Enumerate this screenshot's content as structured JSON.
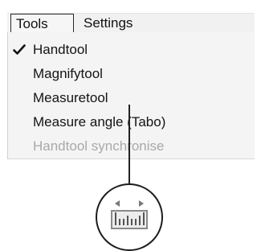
{
  "menubar": {
    "tabs": [
      {
        "label": "Tools",
        "active": true
      },
      {
        "label": "Settings",
        "active": false
      }
    ]
  },
  "tools_menu": {
    "items": [
      {
        "label": "Handtool",
        "checked": true,
        "enabled": true
      },
      {
        "label": "Magnifytool",
        "checked": false,
        "enabled": true
      },
      {
        "label": "Measuretool",
        "checked": false,
        "enabled": true
      },
      {
        "label": "Measure angle (Tabo)",
        "checked": false,
        "enabled": true
      },
      {
        "label": "Handtool synchronise",
        "checked": false,
        "enabled": false
      }
    ]
  },
  "callout": {
    "icon": "ruler-measure-icon"
  },
  "colors": {
    "menu_background": "#f4f4f4",
    "disabled_text": "#a9a9a9",
    "text": "#141414"
  }
}
